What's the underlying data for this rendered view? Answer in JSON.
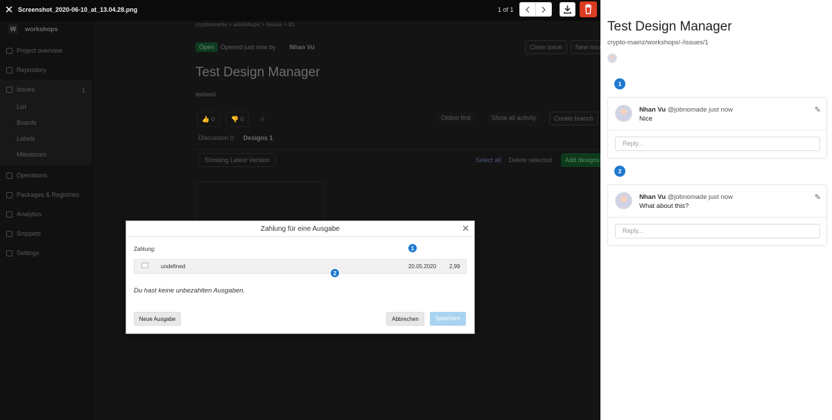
{
  "viewer": {
    "filename": "Screenshot_2020-06-10_at_13.04.28.png",
    "counter": "1 of 1",
    "close_icon": "close-icon",
    "prev_icon": "chevron-left-icon",
    "next_icon": "chevron-right-icon",
    "download_icon": "download-icon",
    "delete_icon": "trash-icon",
    "delete_color": "#db3b21"
  },
  "background": {
    "project_initial": "W",
    "project_name": "workshops",
    "sidebar": [
      "Project overview",
      "Repository",
      "Issues",
      "Operations",
      "Packages & Registries",
      "Analytics",
      "Snippets",
      "Settings"
    ],
    "issues_count": "1",
    "issues_sub": [
      "List",
      "Boards",
      "Labels",
      "Milestones"
    ],
    "breadcrumb": "cryptoevents  >  workshops  >  Issues  >  #1",
    "status": "Open",
    "opened_text": "Opened just now by",
    "author": "Nhan Vu",
    "close_issue": "Close issue",
    "new_issue": "New issu",
    "issue_title": "Test Design Manager",
    "description": "asdasd",
    "thumbs_up": "0",
    "thumbs_down": "0",
    "sort": "Oldest first",
    "activity": "Show all activity",
    "create_branch": "Create branch",
    "tab_discussion": "Discussion",
    "tab_discussion_count": "0",
    "tab_designs": "Designs",
    "tab_designs_count": "1",
    "version": "Showing Latest Version",
    "select_all": "Select all",
    "delete_selected": "Delete selected",
    "add_designs": "Add designs"
  },
  "modal": {
    "title": "Zahlung für eine Ausgabe",
    "label": "Zahlung:",
    "row": {
      "name": "undefined",
      "date": "20.05.2020",
      "amount": "2,99"
    },
    "empty_text": "Du hast keine unbezahlten Ausgaben.",
    "new_button": "Neue Ausgabe",
    "cancel_button": "Abbrechen",
    "save_button": "Speichern",
    "pins": [
      "1",
      "2"
    ]
  },
  "panel": {
    "title": "Test Design Manager",
    "path": "crypto-mainz/workshops/-/issues/1",
    "threads": [
      {
        "pin": "1",
        "author": "Nhan Vu",
        "handle": "@jobnomade just now",
        "message": "Nice",
        "reply_placeholder": "Reply..."
      },
      {
        "pin": "2",
        "author": "Nhan Vu",
        "handle": "@jobnomade just now",
        "message": "What about this?",
        "reply_placeholder": "Reply..."
      }
    ],
    "accent": "#1f78d1"
  }
}
